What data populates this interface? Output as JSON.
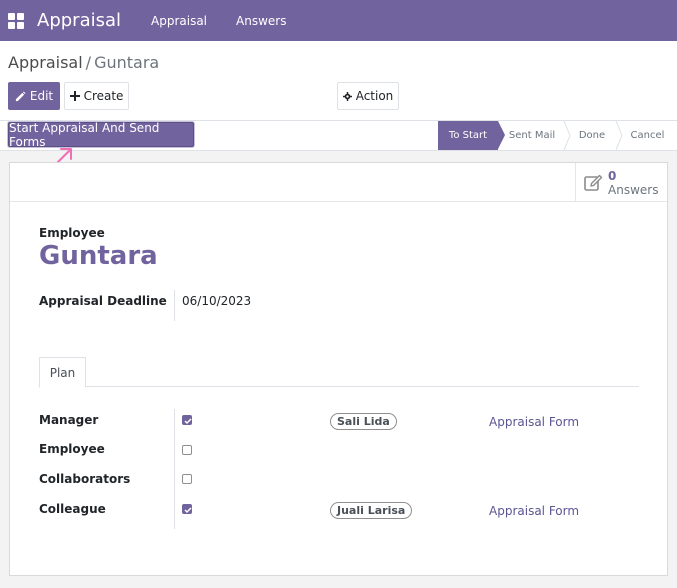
{
  "navbar": {
    "brand": "Appraisal",
    "menu": [
      "Appraisal",
      "Answers"
    ]
  },
  "breadcrumb": {
    "parent": "Appraisal",
    "separator": "/",
    "current": "Guntara"
  },
  "toolbar": {
    "edit_label": "Edit",
    "create_label": "Create",
    "action_label": "Action"
  },
  "statusbar": {
    "start_button": "Start Appraisal And Send Forms",
    "stages": [
      "To Start",
      "Sent Mail",
      "Done",
      "Cancel"
    ],
    "active_stage": "To Start"
  },
  "smart_button": {
    "value": "0",
    "label": "Answers"
  },
  "form": {
    "employee_label": "Employee",
    "employee_name": "Guntara",
    "deadline_label": "Appraisal Deadline",
    "deadline_value": "06/10/2023"
  },
  "tabs": [
    "Plan"
  ],
  "plan": [
    {
      "label": "Manager",
      "checked": true,
      "person": "Sali Lida",
      "form": "Appraisal Form"
    },
    {
      "label": "Employee",
      "checked": false,
      "person": "",
      "form": ""
    },
    {
      "label": "Collaborators",
      "checked": false,
      "person": "",
      "form": ""
    },
    {
      "label": "Colleague",
      "checked": true,
      "person": "Juali Larisa",
      "form": "Appraisal Form"
    }
  ],
  "colors": {
    "brand": "#71639e",
    "annotation_arrow": "#f06fb4"
  }
}
